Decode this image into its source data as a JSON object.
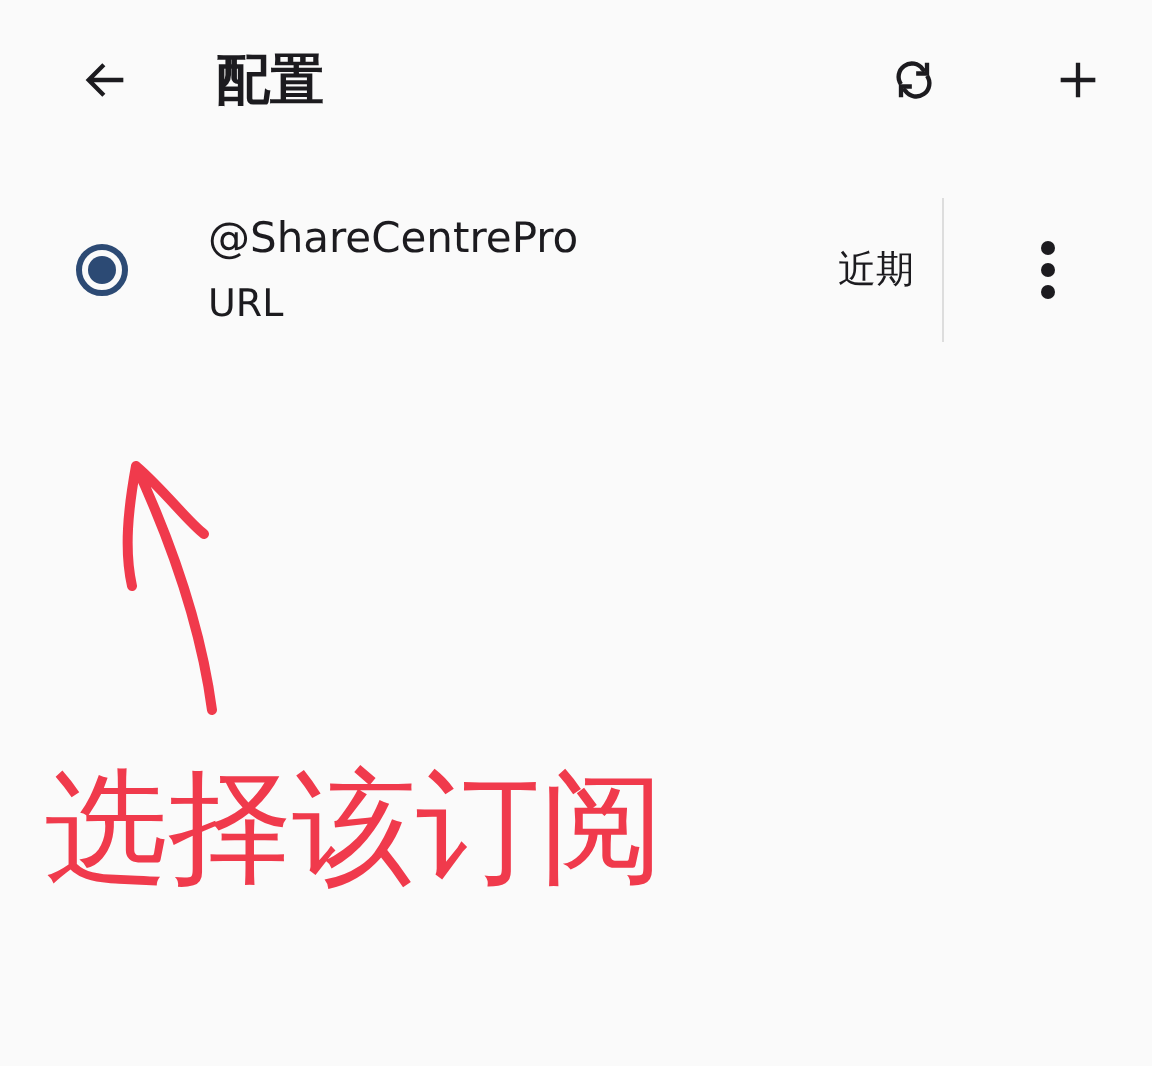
{
  "app_bar": {
    "title": "配置"
  },
  "profiles": [
    {
      "name": "@ShareCentrePro",
      "type": "URL",
      "updated": "近期",
      "selected": true
    }
  ],
  "annotation": {
    "text": "选择该订阅"
  }
}
